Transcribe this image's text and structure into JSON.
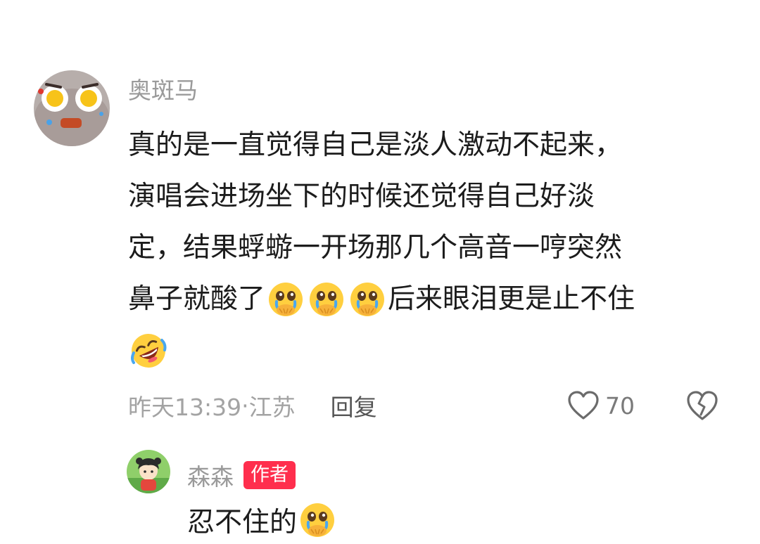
{
  "comment": {
    "username": "奥斑马",
    "lines": [
      "真的是一直觉得自己是淡人激动不起来，",
      "演唱会进场坐下的时候还觉得自己好淡",
      "定，结果蜉蝣一开场那几个高音一哼突然",
      "鼻子就酸了",
      "后来眼泪更是止不住"
    ],
    "emojis": [
      "pleading-crying-hands-emoji",
      "laugh-rolling-emoji"
    ],
    "time": "昨天13:39",
    "separator": " · ",
    "location": "江苏",
    "reply_label": "回复",
    "like_count": "70"
  },
  "reply": {
    "username": "森森",
    "badge": "作者",
    "text": "忍不住的"
  },
  "colors": {
    "username_gray": "#9a9a9a",
    "body_text": "#1c1c1c",
    "meta_gray": "#a3a3a3",
    "badge_red": "#ff2e4d"
  },
  "icons": {
    "like": "heart-outline-icon",
    "dislike": "broken-heart-outline-icon"
  }
}
